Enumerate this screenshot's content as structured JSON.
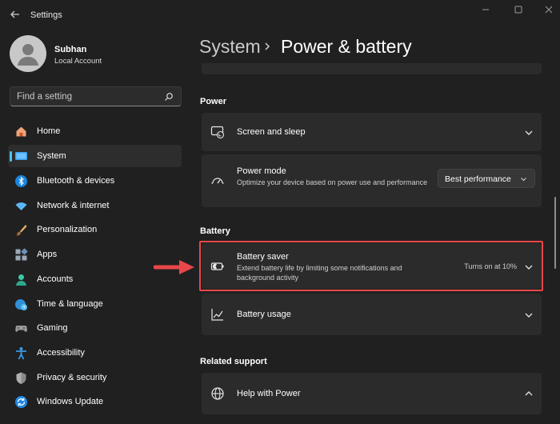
{
  "window": {
    "title": "Settings"
  },
  "user": {
    "name": "Subhan",
    "account_type": "Local Account"
  },
  "search": {
    "placeholder": "Find a setting"
  },
  "nav": {
    "items": [
      {
        "label": "Home",
        "icon": "home-icon",
        "selected": false
      },
      {
        "label": "System",
        "icon": "system-icon",
        "selected": true
      },
      {
        "label": "Bluetooth & devices",
        "icon": "bluetooth-icon",
        "selected": false
      },
      {
        "label": "Network & internet",
        "icon": "wifi-icon",
        "selected": false
      },
      {
        "label": "Personalization",
        "icon": "brush-icon",
        "selected": false
      },
      {
        "label": "Apps",
        "icon": "apps-icon",
        "selected": false
      },
      {
        "label": "Accounts",
        "icon": "accounts-icon",
        "selected": false
      },
      {
        "label": "Time & language",
        "icon": "globe-clock-icon",
        "selected": false
      },
      {
        "label": "Gaming",
        "icon": "gamepad-icon",
        "selected": false
      },
      {
        "label": "Accessibility",
        "icon": "accessibility-icon",
        "selected": false
      },
      {
        "label": "Privacy & security",
        "icon": "shield-icon",
        "selected": false
      },
      {
        "label": "Windows Update",
        "icon": "update-icon",
        "selected": false
      }
    ]
  },
  "breadcrumb": {
    "parent": "System",
    "current": "Power & battery"
  },
  "power": {
    "header": "Power",
    "screen_sleep": {
      "title": "Screen and sleep"
    },
    "power_mode": {
      "title": "Power mode",
      "description": "Optimize your device based on power use and performance",
      "value": "Best performance"
    }
  },
  "battery": {
    "header": "Battery",
    "saver": {
      "title": "Battery saver",
      "description": "Extend battery life by limiting some notifications and background activity",
      "status": "Turns on at 10%"
    },
    "usage": {
      "title": "Battery usage"
    }
  },
  "support": {
    "header": "Related support",
    "help": {
      "title": "Help with Power"
    }
  },
  "colors": {
    "background": "#202020",
    "card": "#2b2b2b",
    "accent": "#4cc2ff",
    "highlight": "#e8474a"
  }
}
